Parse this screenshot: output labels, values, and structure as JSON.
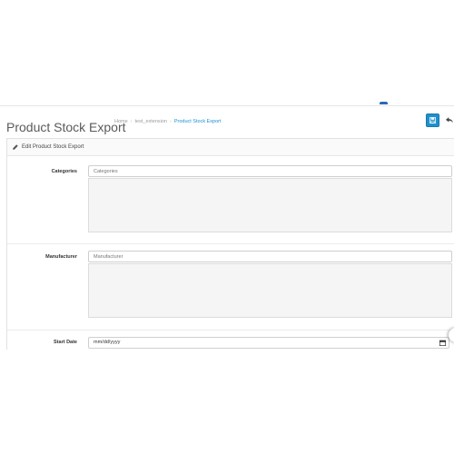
{
  "header": {
    "title": "Product Stock Export",
    "breadcrumb": [
      {
        "label": "Home"
      },
      {
        "label": "test_extension"
      },
      {
        "label": "Product Stock Export"
      }
    ],
    "breadcrumb_separator": "›",
    "save_icon": "save-icon",
    "back_icon": "reply-icon"
  },
  "panel": {
    "heading": "Edit Product Stock Export",
    "heading_icon": "pencil-icon"
  },
  "form": {
    "categories": {
      "label": "Categories",
      "placeholder": "Categories"
    },
    "manufacturer": {
      "label": "Manufacturer",
      "placeholder": "Manufacturer"
    },
    "start_date": {
      "label": "Start Date",
      "placeholder": "mm/dd/yyyy",
      "icon": "calendar-icon"
    }
  },
  "colors": {
    "accent": "#1e91cf",
    "title": "#5a5a5a",
    "well": "#f5f5f5"
  }
}
